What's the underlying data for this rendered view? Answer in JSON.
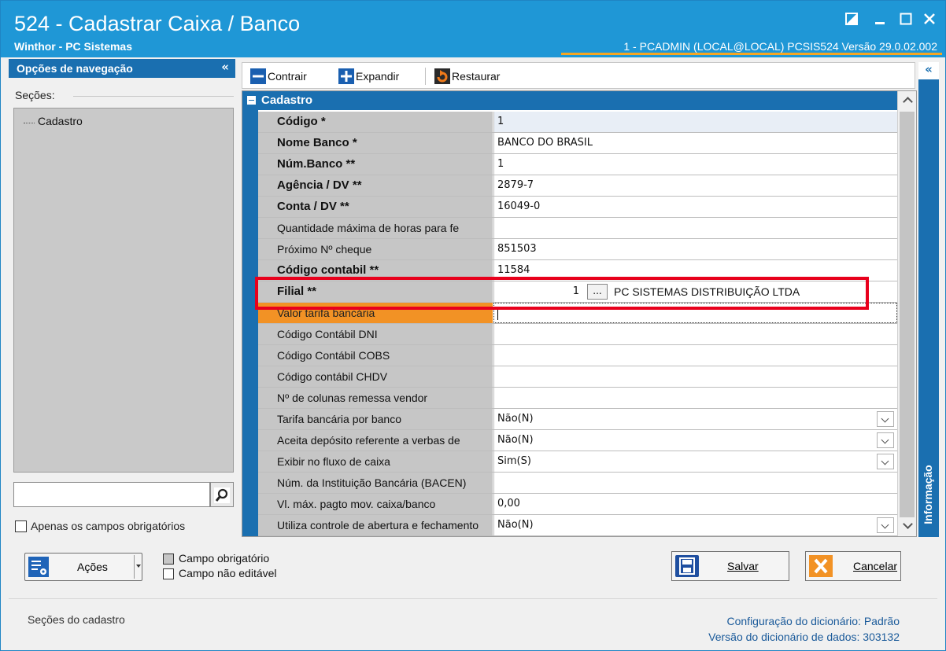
{
  "window": {
    "title": "524 - Cadastrar Caixa / Banco",
    "subtitle": "Winthor - PC Sistemas",
    "user_info": "1 - PCADMIN (LOCAL@LOCAL)  PCSIS524  Versão  29.0.02.002"
  },
  "nav": {
    "title": "Opções de navegação",
    "collapse": "«",
    "sections_label": "Seções:",
    "tree_item": "Cadastro",
    "required_only_label": "Apenas os campos obrigatórios"
  },
  "toolbar": {
    "contract": "Contrair",
    "expand": "Expandir",
    "restore": "Restaurar",
    "info_collapse": "«"
  },
  "group": {
    "title": "Cadastro"
  },
  "fields": [
    {
      "label": "Código *",
      "value": "1"
    },
    {
      "label": "Nome Banco *",
      "value": "BANCO DO BRASIL"
    },
    {
      "label": "Núm.Banco  **",
      "value": "1"
    },
    {
      "label": "Agência / DV  **",
      "value": "2879-7"
    },
    {
      "label": "Conta / DV  **",
      "value": "16049-0"
    },
    {
      "label": "Quantidade máxima de horas para fe",
      "value": ""
    },
    {
      "label": "Próximo Nº cheque",
      "value": "851503"
    },
    {
      "label": "Código contabil **",
      "value": "11584"
    },
    {
      "label": "Filial **",
      "value": "1"
    },
    {
      "label": "Valor tarifa bancária",
      "value": ""
    },
    {
      "label": "Código Contábil DNI",
      "value": ""
    },
    {
      "label": "Código Contábil COBS",
      "value": ""
    },
    {
      "label": "Código contábil CHDV",
      "value": ""
    },
    {
      "label": "Nº de colunas remessa vendor",
      "value": ""
    },
    {
      "label": "Tarifa bancária por banco",
      "value": "Não(N)"
    },
    {
      "label": "Aceita depósito referente a verbas de",
      "value": "Não(N)"
    },
    {
      "label": "Exibir no fluxo de caixa",
      "value": "Sim(S)"
    },
    {
      "label": "Núm. da Instituição Bancária (BACEN)",
      "value": ""
    },
    {
      "label": "Vl. máx. pagto mov. caixa/banco",
      "value": "0,00"
    },
    {
      "label": "Utiliza controle de abertura e fechamento",
      "value": "Não(N)"
    }
  ],
  "filial": {
    "button": "...",
    "name": "PC SISTEMAS DISTRIBUIÇÃO LTDA"
  },
  "info_panel": {
    "label": "Informação"
  },
  "bottom": {
    "actions": "Ações",
    "legend_required": "Campo obrigatório",
    "legend_not_editable": "Campo não editável",
    "save": "Salvar",
    "cancel": "Cancelar"
  },
  "status": {
    "left": "Seções do cadastro",
    "dict_config_label": "Configuração do dicionário:",
    "dict_config_value": "Padrão",
    "dict_version_label": "Versão do dicionário de dados:",
    "dict_version_value": "303132"
  },
  "colors": {
    "title_bar": "#1f97d6",
    "panel_blue": "#1a6fb0",
    "active_row": "#f29225",
    "highlight": "#e8001c"
  }
}
